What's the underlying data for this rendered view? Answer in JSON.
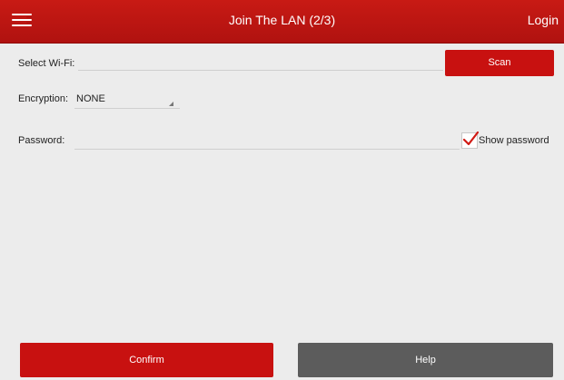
{
  "header": {
    "title": "Join The LAN (2/3)",
    "login_label": "Login"
  },
  "form": {
    "wifi_label": "Select Wi-Fi:",
    "wifi_value": "",
    "scan_label": "Scan",
    "encryption_label": "Encryption:",
    "encryption_value": "NONE",
    "password_label": "Password:",
    "password_value": "",
    "show_password_label": "Show password",
    "show_password_checked": true
  },
  "footer": {
    "confirm_label": "Confirm",
    "help_label": "Help"
  },
  "colors": {
    "accent": "#c81110",
    "secondary": "#5c5c5c",
    "background": "#ececec"
  },
  "icons": {
    "menu": "menu-icon",
    "check": "check-icon",
    "dropdown": "dropdown-arrow-icon"
  }
}
